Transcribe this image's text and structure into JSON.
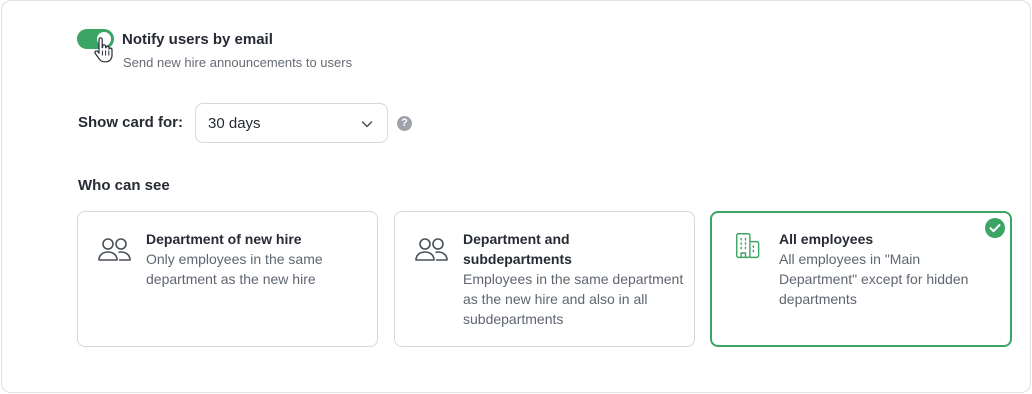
{
  "notify": {
    "enabled": true,
    "title": "Notify users by email",
    "subtitle": "Send new hire announcements to users"
  },
  "show_card": {
    "label": "Show card for:",
    "selected": "30 days",
    "help": "?"
  },
  "visibility": {
    "label": "Who can see",
    "options": [
      {
        "title": "Department of new hire",
        "description": "Only employees in the same department as the new hire",
        "icon": "users-icon",
        "selected": false
      },
      {
        "title": "Department and subdepartments",
        "description": "Employees in the same department as the new hire and also in all subdepartments",
        "icon": "users-icon",
        "selected": false
      },
      {
        "title": "All employees",
        "description": "All employees in \"Main Department\" except for hidden departments",
        "icon": "building-icon",
        "selected": true
      }
    ]
  },
  "colors": {
    "accent": "#3aa564",
    "border": "#d5d9df",
    "text": "#262b33",
    "muted": "#5f6670"
  }
}
